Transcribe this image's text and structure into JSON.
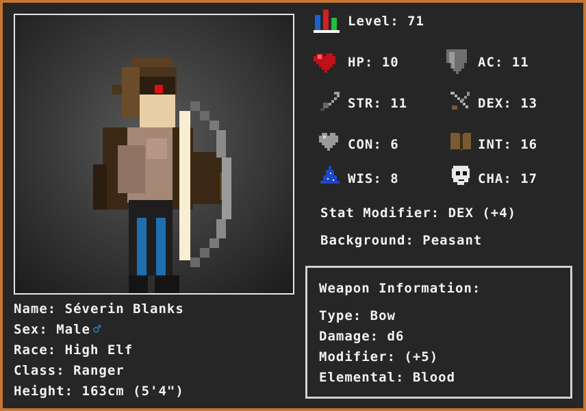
{
  "level": {
    "label": "Level:",
    "value": "71",
    "icon": "level-bars-icon"
  },
  "stats": [
    {
      "id": "hp",
      "label": "HP:",
      "value": "10",
      "icon": "heart-icon"
    },
    {
      "id": "ac",
      "label": "AC:",
      "value": "11",
      "icon": "shield-icon"
    },
    {
      "id": "str",
      "label": "STR:",
      "value": "11",
      "icon": "sword-icon"
    },
    {
      "id": "dex",
      "label": "DEX:",
      "value": "13",
      "icon": "crossed-daggers-icon"
    },
    {
      "id": "con",
      "label": "CON:",
      "value": "6",
      "icon": "grey-heart-icon"
    },
    {
      "id": "int",
      "label": "INT:",
      "value": "16",
      "icon": "book-icon"
    },
    {
      "id": "wis",
      "label": "WIS:",
      "value": "8",
      "icon": "wizard-hat-icon"
    },
    {
      "id": "cha",
      "label": "CHA:",
      "value": "17",
      "icon": "mask-icon"
    }
  ],
  "stat_modifier": "Stat Modifier: DEX (+4)",
  "background": "Background: Peasant",
  "character": {
    "name": "Name: Séverin Blanks",
    "sex": "Sex: Male",
    "sex_symbol": "♂",
    "race": "Race: High Elf",
    "class": "Class: Ranger",
    "height": "Height: 163cm (5'4\")"
  },
  "weapon": {
    "title": "Weapon Information:",
    "type": "Type: Bow",
    "damage": "Damage: d6",
    "modifier": "Modifier: (+5)",
    "elemental": "Elemental: Blood"
  },
  "colors": {
    "frame": "#c8762f",
    "panel": "#262626",
    "accent_blue": "#2f8fd6",
    "eye": "#e01010"
  }
}
